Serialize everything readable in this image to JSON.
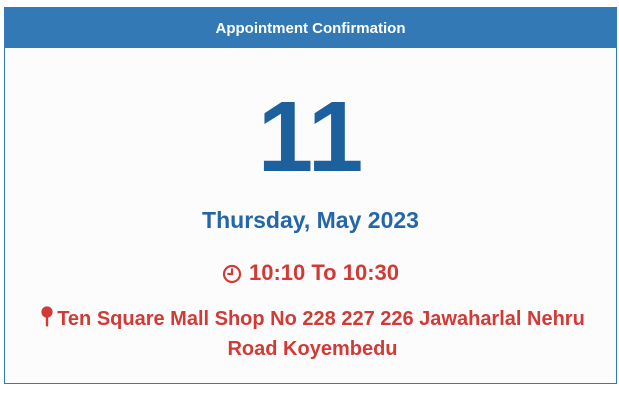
{
  "header": {
    "title": "Appointment Confirmation"
  },
  "appointment": {
    "day": "11",
    "weekday_month_year": "Thursday, May 2023",
    "time_range": "10:10 To 10:30",
    "location": "Ten Square Mall Shop No 228 227 226 Jawaharlal Nehru Road Koyembedu"
  },
  "icons": {
    "time": "clock-icon",
    "location": "map-pin-icon"
  },
  "colors": {
    "header_background": "#3379b5",
    "date_blue": "#1c609d",
    "accent_red": "#d23a36"
  }
}
